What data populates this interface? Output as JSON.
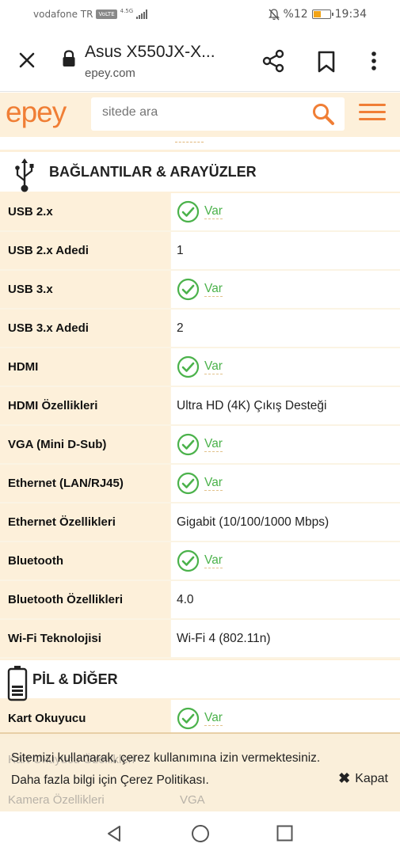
{
  "status_bar": {
    "carrier": "vodafone TR",
    "volte": "VoLTE",
    "network": "4.5G",
    "battery_percent": "%12",
    "time": "19:34"
  },
  "browser": {
    "title": "Asus X550JX-X...",
    "url": "epey.com"
  },
  "site": {
    "logo": "epey",
    "search_placeholder": "sitede ara"
  },
  "sections": [
    {
      "title": "BAĞLANTILAR & ARAYÜZLER",
      "icon": "usb-icon",
      "rows": [
        {
          "label": "USB 2.x",
          "value": "Var",
          "check": true
        },
        {
          "label": "USB 2.x Adedi",
          "value": "1",
          "check": false
        },
        {
          "label": "USB 3.x",
          "value": "Var",
          "check": true
        },
        {
          "label": "USB 3.x Adedi",
          "value": "2",
          "check": false
        },
        {
          "label": "HDMI",
          "value": "Var",
          "check": true
        },
        {
          "label": "HDMI Özellikleri",
          "value": "Ultra HD (4K) Çıkış Desteği",
          "check": false
        },
        {
          "label": "VGA (Mini D-Sub)",
          "value": "Var",
          "check": true
        },
        {
          "label": "Ethernet (LAN/RJ45)",
          "value": "Var",
          "check": true
        },
        {
          "label": "Ethernet Özellikleri",
          "value": "Gigabit (10/100/1000 Mbps)",
          "check": false
        },
        {
          "label": "Bluetooth",
          "value": "Var",
          "check": true
        },
        {
          "label": "Bluetooth Özellikleri",
          "value": "4.0",
          "check": false
        },
        {
          "label": "Wi-Fi Teknolojisi",
          "value": "Wi-Fi 4 (802.11n)",
          "check": false
        }
      ]
    },
    {
      "title": "PİL & DİĞER",
      "icon": "battery-icon",
      "rows": [
        {
          "label": "Kart Okuyucu",
          "value": "Var",
          "check": true
        }
      ]
    }
  ],
  "cookie": {
    "line1": "Sitemizi kullanarak, çerez kullanımına izin vermektesiniz.",
    "line2": "Daha fazla bilgi için Çerez Politikası.",
    "close_label": "Kapat",
    "behind_row1": "Kart Okuyucu Özellikleri",
    "behind_row2": "Kamera Özellikleri",
    "behind_value2": "VGA"
  },
  "colors": {
    "brand": "#f07e35",
    "label_bg": "#fdf0da",
    "check_green": "#4bb24b"
  }
}
